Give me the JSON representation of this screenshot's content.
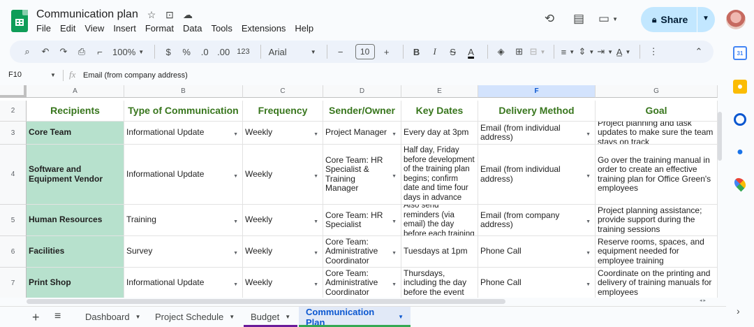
{
  "app": {
    "title": "Communication plan",
    "menu": [
      "File",
      "Edit",
      "View",
      "Insert",
      "Format",
      "Data",
      "Tools",
      "Extensions",
      "Help"
    ],
    "share_label": "Share"
  },
  "toolbar": {
    "zoom": "100%",
    "currency": "$",
    "percent": "%",
    "dec_less": ".0",
    "dec_more": ".00",
    "num_format": "123",
    "font": "Arial",
    "font_size": "10",
    "bold": "B",
    "italic": "I",
    "strike": "S",
    "text_color": "A"
  },
  "formula_bar": {
    "cell_ref": "F10",
    "fx": "fx",
    "content": "Email (from company address)"
  },
  "columns": [
    "A",
    "B",
    "C",
    "D",
    "E",
    "F",
    "G"
  ],
  "selected_column": "F",
  "header_row": {
    "row_num": "2",
    "cells": [
      "Recipients",
      "Type of Communication",
      "Frequency",
      "Sender/Owner",
      "Key Dates",
      "Delivery Method",
      "Goal"
    ]
  },
  "rows": [
    {
      "row_num": "3",
      "cells": [
        "Core Team",
        "Informational Update",
        "Weekly",
        "Project Manager",
        "Every day at 3pm",
        "Email (from individual address)",
        "Project planning and task updates to make sure the team stays on track"
      ]
    },
    {
      "row_num": "4",
      "cells": [
        "Software and Equipment Vendor",
        "Informational Update",
        "Weekly",
        "Core Team: HR Specialist & Training Manager",
        "Half day, Friday before development of the training plan begins; confirm date and time four days in advance",
        "Email (from individual address)",
        "Go over the training manual in order to create an effective training plan for Office Green's employees"
      ]
    },
    {
      "row_num": "5",
      "cells": [
        "Human Resources",
        "Training",
        "Weekly",
        "Core Team: HR Specialist",
        "Also send reminders (via email) the day before each training",
        "Email (from company address)",
        "Project planning assistance; provide support during the training sessions"
      ]
    },
    {
      "row_num": "6",
      "cells": [
        "Facilities",
        "Survey",
        "Weekly",
        "Core Team: Administrative Coordinator",
        "Tuesdays at 1pm",
        "Phone Call",
        "Reserve rooms, spaces, and equipment needed for employee training"
      ]
    },
    {
      "row_num": "7",
      "cells": [
        "Print Shop",
        "Informational Update",
        "Weekly",
        "Core Team: Administrative Coordinator",
        "Thursdays, including the day before the event",
        "Phone Call",
        "Coordinate on the printing and delivery of training manuals for employees"
      ]
    }
  ],
  "sheet_tabs": [
    {
      "label": "Dashboard",
      "color": "#ffffff",
      "active": false
    },
    {
      "label": "Project Schedule",
      "color": "#ffffff",
      "active": false
    },
    {
      "label": "Budget",
      "color": "#6a1b9a",
      "active": false
    },
    {
      "label": "Communication Plan",
      "color": "#34a853",
      "active": true
    }
  ],
  "colors": {
    "header_text": "#38761d",
    "recipient_fill": "#b7e1cd",
    "selected_col": "#d3e3fd",
    "share_bg": "#c2e7ff"
  }
}
